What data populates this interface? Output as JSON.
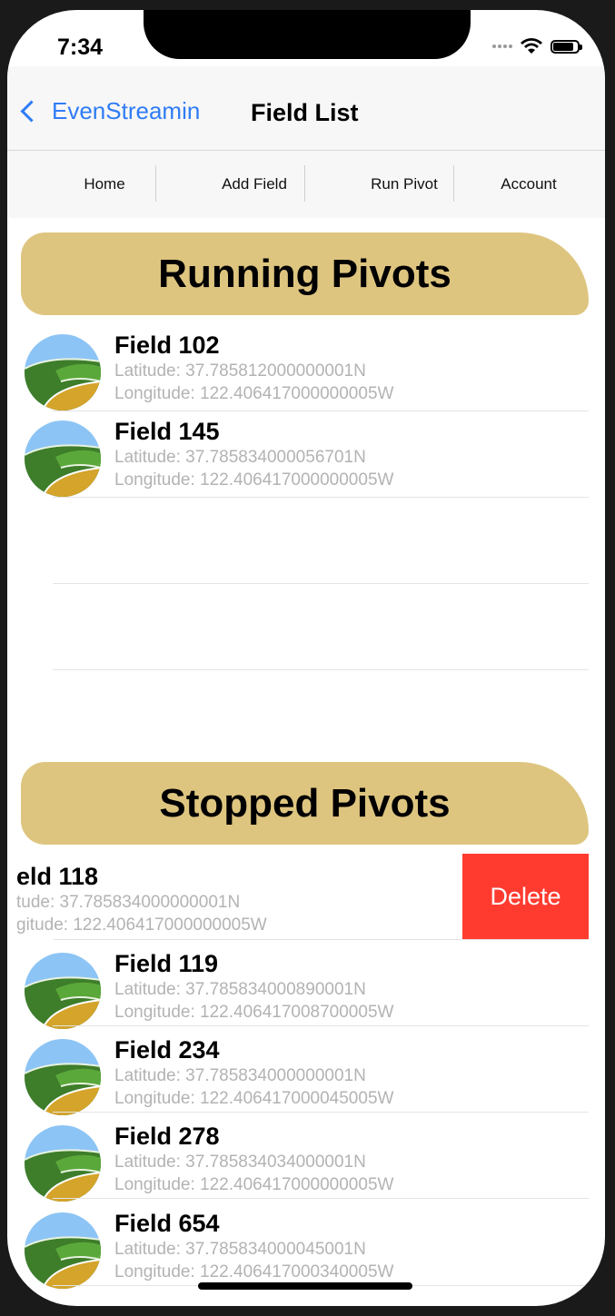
{
  "status": {
    "time": "7:34"
  },
  "nav": {
    "back_label": "EvenStreamin",
    "title": "Field List"
  },
  "toolbar": {
    "home": "Home",
    "add_field": "Add Field",
    "run_pivot": "Run Pivot",
    "account": "Account"
  },
  "running": {
    "header": "Running Pivots",
    "rows": [
      {
        "title": "Field 102",
        "lat": "Latitude: 37.785812000000001N",
        "lon": "Longitude: 122.406417000000005W"
      },
      {
        "title": "Field 145",
        "lat": "Latitude: 37.785834000056701N",
        "lon": "Longitude: 122.406417000000005W"
      }
    ]
  },
  "stopped": {
    "header": "Stopped Pivots",
    "swiped_row": {
      "title": "eld 118",
      "lat": "tude: 37.785834000000001N",
      "lon": "gitude: 122.406417000000005W",
      "delete_label": "Delete"
    },
    "rows": [
      {
        "title": "Field 119",
        "lat": "Latitude: 37.785834000890001N",
        "lon": "Longitude: 122.406417008700005W"
      },
      {
        "title": "Field 234",
        "lat": "Latitude: 37.785834000000001N",
        "lon": "Longitude: 122.406417000045005W"
      },
      {
        "title": "Field 278",
        "lat": "Latitude: 37.785834034000001N",
        "lon": "Longitude: 122.406417000000005W"
      },
      {
        "title": "Field 654",
        "lat": "Latitude: 37.785834000045001N",
        "lon": "Longitude: 122.406417000340005W"
      }
    ]
  },
  "colors": {
    "accent": "#2f7cf6",
    "section_header": "#dec57f",
    "delete": "#ff3b30",
    "subtitle": "#b3b3b3"
  },
  "icons": {
    "field_thumbnail": "field-landscape-icon",
    "back": "chevron-left-icon",
    "wifi": "wifi-icon",
    "battery": "battery-icon",
    "signal": "signal-icon"
  },
  "battery_level": 0.9
}
